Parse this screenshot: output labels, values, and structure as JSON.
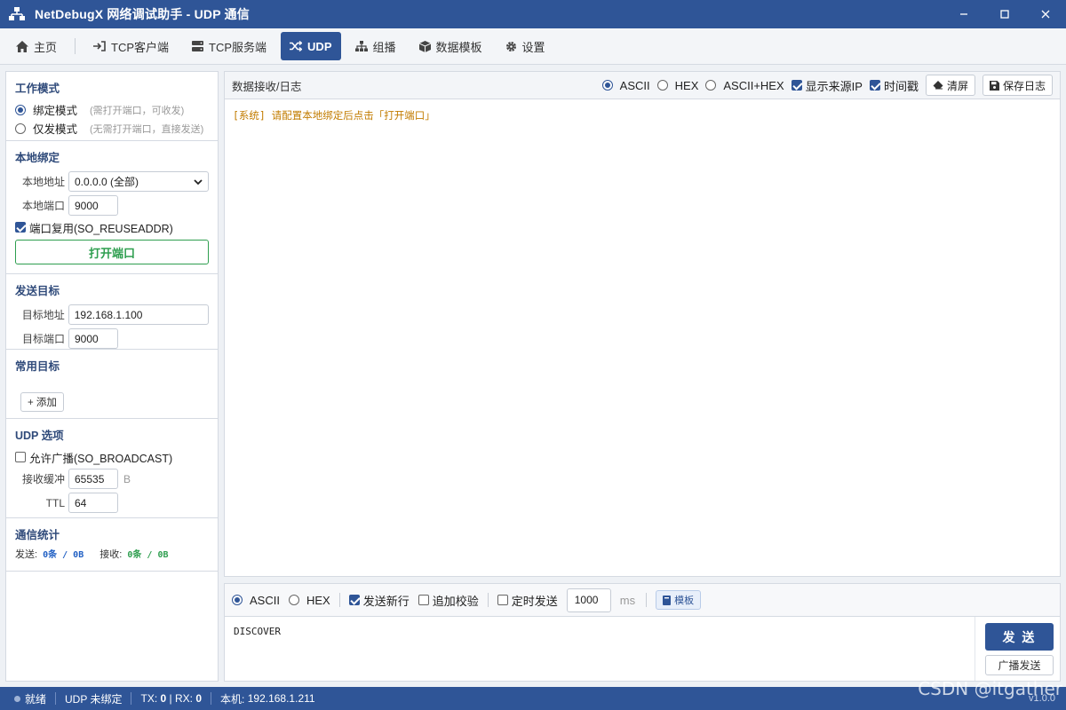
{
  "window": {
    "title": "NetDebugX 网络调试助手 - UDP 通信"
  },
  "tabs": [
    {
      "label": "主页",
      "icon": "home-icon"
    },
    {
      "label": "TCP客户端",
      "icon": "sign-in-icon"
    },
    {
      "label": "TCP服务端",
      "icon": "server-icon"
    },
    {
      "label": "UDP",
      "icon": "shuffle-icon",
      "active": true
    },
    {
      "label": "组播",
      "icon": "sitemap-icon"
    },
    {
      "label": "数据模板",
      "icon": "cube-icon"
    },
    {
      "label": "设置",
      "icon": "gear-icon"
    }
  ],
  "work_mode": {
    "title": "工作模式",
    "options": [
      {
        "label": "绑定模式",
        "hint": "(需打开端口，可收发)",
        "selected": true
      },
      {
        "label": "仅发模式",
        "hint": "(无需打开端口，直接发送)",
        "selected": false
      }
    ]
  },
  "local_bind": {
    "title": "本地绑定",
    "address_label": "本地地址",
    "address_value": "0.0.0.0 (全部)",
    "port_label": "本地端口",
    "port_value": "9000",
    "reuse_label": "端口复用(SO_REUSEADDR)",
    "reuse_checked": true,
    "open_button": "打开端口"
  },
  "send_target": {
    "title": "发送目标",
    "address_label": "目标地址",
    "address_value": "192.168.1.100",
    "port_label": "目标端口",
    "port_value": "9000"
  },
  "common_targets": {
    "title": "常用目标",
    "add_button": "+ 添加"
  },
  "udp_options": {
    "title": "UDP 选项",
    "broadcast_label": "允许广播(SO_BROADCAST)",
    "broadcast_checked": false,
    "buffer_label": "接收缓冲",
    "buffer_value": "65535",
    "buffer_unit": "B",
    "ttl_label": "TTL",
    "ttl_value": "64"
  },
  "stats": {
    "title": "通信统计",
    "send_label": "发送:",
    "send_value": "0条 / 0B",
    "recv_label": "接收:",
    "recv_value": "0条 / 0B"
  },
  "receive": {
    "title": "数据接收/日志",
    "formats": [
      {
        "label": "ASCII",
        "selected": true
      },
      {
        "label": "HEX",
        "selected": false
      },
      {
        "label": "ASCII+HEX",
        "selected": false
      }
    ],
    "show_source_ip": {
      "label": "显示来源IP",
      "checked": true
    },
    "timestamp": {
      "label": "时间戳",
      "checked": true
    },
    "clear_button": "清屏",
    "save_button": "保存日志",
    "log_line": "[系统] 请配置本地绑定后点击「打开端口」"
  },
  "send": {
    "formats": [
      {
        "label": "ASCII",
        "selected": true
      },
      {
        "label": "HEX",
        "selected": false
      }
    ],
    "newline": {
      "label": "发送新行",
      "checked": true
    },
    "checksum": {
      "label": "追加校验",
      "checked": false
    },
    "timed": {
      "label": "定时发送",
      "checked": false
    },
    "interval_value": "1000",
    "interval_unit": "ms",
    "template_button": "模板",
    "content": "DISCOVER",
    "send_button": "发 送",
    "broadcast_button": "广播发送"
  },
  "statusbar": {
    "status": "就绪",
    "udp_state": "UDP 未绑定",
    "tx_label": "TX:",
    "tx_value": "0",
    "rx_label": "RX:",
    "rx_value": "0",
    "local_label": "本机:",
    "local_value": "192.168.1.211",
    "version": "v1.0.0"
  },
  "watermark": "CSDN @itgather",
  "colors": {
    "primary": "#2f5597",
    "success": "#2e9e4f",
    "log_system": "#c27c00"
  }
}
